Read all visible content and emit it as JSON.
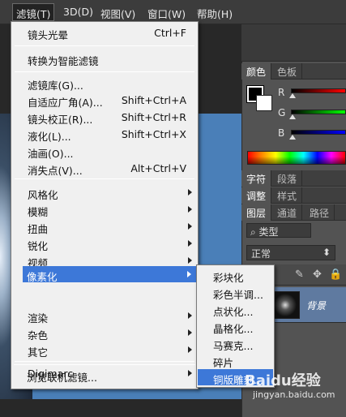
{
  "menubar": {
    "items": [
      "滤镜(T)",
      "3D(D)",
      "视图(V)",
      "窗口(W)",
      "帮助(H)"
    ]
  },
  "filter_menu": {
    "last_filter": "镜头光晕",
    "last_filter_shortcut": "Ctrl+F",
    "convert_smart": "转换为智能滤镜",
    "gallery": "滤镜库(G)...",
    "adaptive_wide": "自适应广角(A)...",
    "adaptive_wide_shortcut": "Shift+Ctrl+A",
    "lens_correction": "镜头校正(R)...",
    "lens_correction_shortcut": "Shift+Ctrl+R",
    "liquify": "液化(L)...",
    "liquify_shortcut": "Shift+Ctrl+X",
    "oil_paint": "油画(O)...",
    "vanishing_point": "消失点(V)...",
    "vanishing_point_shortcut": "Alt+Ctrl+V",
    "groups": [
      "风格化",
      "模糊",
      "扭曲",
      "锐化",
      "视频",
      "像素化",
      "渲染",
      "杂色",
      "其它"
    ],
    "digimarc": "Digimarc",
    "browse_online": "浏览联机滤镜..."
  },
  "pixelate_submenu": {
    "items": [
      "彩块化",
      "彩色半调...",
      "点状化...",
      "晶格化...",
      "马赛克...",
      "碎片",
      "铜版雕刻..."
    ],
    "selected": "铜版雕刻..."
  },
  "panels": {
    "color_tabs": [
      "颜色",
      "色板"
    ],
    "channels": [
      "R",
      "G",
      "B"
    ],
    "char_tabs": [
      "字符",
      "段落"
    ],
    "adjust_tabs": [
      "调整",
      "样式"
    ],
    "layer_tabs": [
      "图层",
      "通道",
      "路径"
    ],
    "kind_label": "类型",
    "blend_mode": "正常",
    "layer_name": "背景"
  },
  "watermark": {
    "logo": "Baidu经验",
    "url": "jingyan.baidu.com"
  },
  "colors": {
    "accent": "#3d78d8",
    "menu_bg": "#f0f0f0",
    "document": "#4a7fb8"
  }
}
